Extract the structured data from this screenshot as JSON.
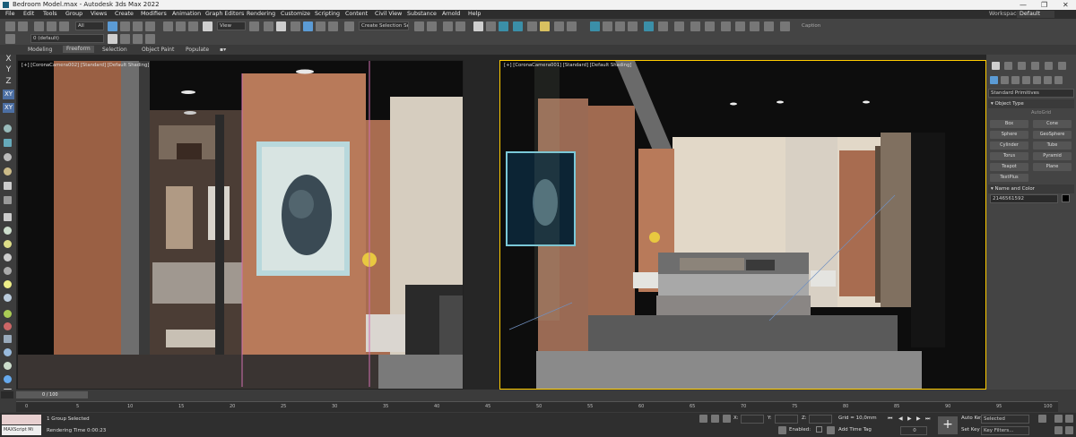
{
  "window": {
    "title": "Bedroom Model.max - Autodesk 3ds Max 2022",
    "minimize": "—",
    "restore": "❐",
    "close": "✕"
  },
  "menu": [
    "File",
    "Edit",
    "Tools",
    "Group",
    "Views",
    "Create",
    "Modifiers",
    "Animation",
    "Graph Editors",
    "Rendering",
    "Customize",
    "Scripting",
    "Content",
    "Civil View",
    "Substance",
    "Arnold",
    "Help"
  ],
  "workspaces": {
    "label": "Workspaces:",
    "value": "Default"
  },
  "toolbar": {
    "selection_filter": "All",
    "ref_coord": "View",
    "named_selection": "Create Selection Se",
    "caption": "Caption"
  },
  "layer": {
    "value": "0 (default)"
  },
  "ribbon": {
    "tabs": [
      "Modeling",
      "Freeform",
      "Selection",
      "Object Paint",
      "Populate"
    ],
    "active": "Freeform"
  },
  "axes": [
    "X",
    "Y",
    "Z",
    "XY",
    "XY"
  ],
  "viewports": {
    "left": {
      "label": "[+] [CoronaCamera002] [Standard] [Default Shading]"
    },
    "right": {
      "label": "[+] [CoronaCamera001] [Standard] [Default Shading]"
    }
  },
  "command_panel": {
    "category": "Standard Primitives",
    "object_type_title": "Object Type",
    "autogrid": "AutoGrid",
    "buttons": [
      "Box",
      "Cone",
      "Sphere",
      "GeoSphere",
      "Cylinder",
      "Tube",
      "Torus",
      "Pyramid",
      "Teapot",
      "Plane",
      "TextPlus"
    ],
    "name_color_title": "Name and Color",
    "name_value": "2146561592"
  },
  "timeline": {
    "frame": "0 / 100",
    "ticks": [
      "0",
      "5",
      "10",
      "15",
      "20",
      "25",
      "30",
      "35",
      "40",
      "45",
      "50",
      "55",
      "60",
      "65",
      "70",
      "75",
      "80",
      "85",
      "90",
      "95",
      "100"
    ]
  },
  "status": {
    "maxscript": "MAXScript Mi",
    "selection": "1 Group Selected",
    "render_time": "Rendering Time  0:00:23",
    "x_label": "X:",
    "y_label": "Y:",
    "z_label": "Z:",
    "grid": "Grid = 10,0mm",
    "enabled": "Enabled:",
    "add_time_tag": "Add Time Tag",
    "auto_key": "Auto Key",
    "set_key": "Set Key",
    "key_mode": "Selected",
    "key_filters": "Key Filters...",
    "frame_value": "0"
  },
  "colors": {
    "accent": "#5b9bd5",
    "wall_wood": "#b87a5a",
    "panel_bg": "#444444"
  }
}
